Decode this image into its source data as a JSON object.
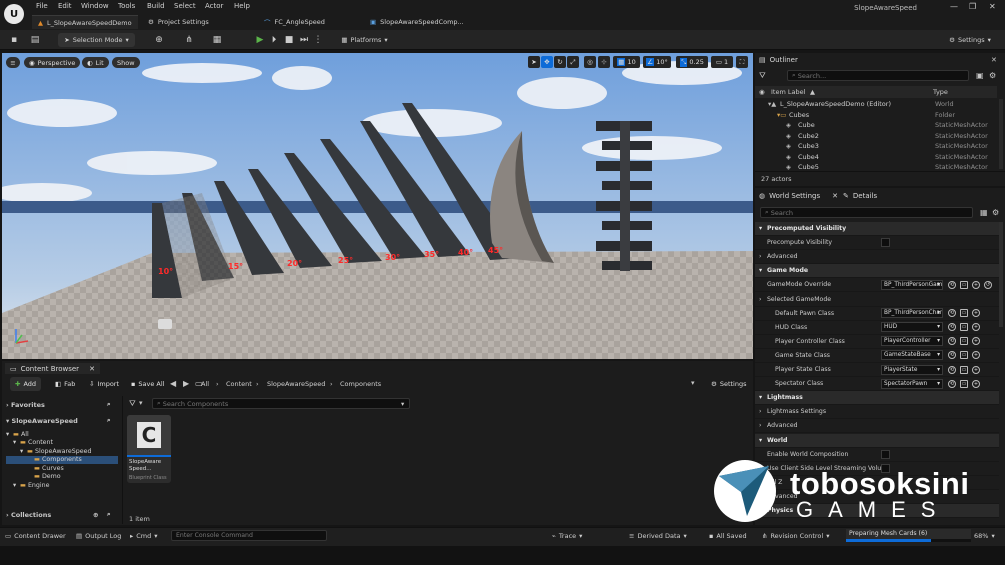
{
  "menu": [
    "File",
    "Edit",
    "Window",
    "Tools",
    "Build",
    "Select",
    "Actor",
    "Help"
  ],
  "window_title": "SlopeAwareSpeed",
  "doc_tabs": [
    "L_SlopeAwareSpeedDemo",
    "Project Settings",
    "FC_AngleSpeed",
    "SlopeAwareSpeedComp..."
  ],
  "toolbar": {
    "selection_mode": "Selection Mode",
    "platforms": "Platforms",
    "settings": "Settings"
  },
  "viewport": {
    "perspective": "Perspective",
    "lit": "Lit",
    "show": "Show",
    "grid_snap": "10",
    "rotation_snap": "10°",
    "scale_snap": "0.25",
    "camera_speed": "1",
    "angle_labels": [
      "10°",
      "15°",
      "20°",
      "25°",
      "30°",
      "35°",
      "40°",
      "45°"
    ]
  },
  "outliner": {
    "tab": "Outliner",
    "search_placeholder": "Search...",
    "col_label": "Item Label",
    "col_type": "Type",
    "rows": [
      {
        "label": "L_SlopeAwareSpeedDemo (Editor)",
        "type": "World",
        "indent": 1
      },
      {
        "label": "Cubes",
        "type": "Folder",
        "indent": 2
      },
      {
        "label": "Cube",
        "type": "StaticMeshActor",
        "indent": 3
      },
      {
        "label": "Cube2",
        "type": "StaticMeshActor",
        "indent": 3
      },
      {
        "label": "Cube3",
        "type": "StaticMeshActor",
        "indent": 3
      },
      {
        "label": "Cube4",
        "type": "StaticMeshActor",
        "indent": 3
      },
      {
        "label": "Cube5",
        "type": "StaticMeshActor",
        "indent": 3
      }
    ],
    "actor_count": "27 actors"
  },
  "world_settings": {
    "tab": "World Settings",
    "details_tab": "Details",
    "search_placeholder": "Search",
    "rows": [
      {
        "kind": "cat",
        "label": "Precomputed Visibility"
      },
      {
        "kind": "check",
        "label": "Precompute Visibility"
      },
      {
        "kind": "sub",
        "label": "Advanced"
      },
      {
        "kind": "cat",
        "label": "Game Mode"
      },
      {
        "kind": "drop",
        "label": "GameMode Override",
        "value": "BP_ThirdPersonGameMode"
      },
      {
        "kind": "sub",
        "label": "Selected GameMode"
      },
      {
        "kind": "drop",
        "label": "Default Pawn Class",
        "value": "BP_ThirdPersonCharacter"
      },
      {
        "kind": "drop",
        "label": "HUD Class",
        "value": "HUD"
      },
      {
        "kind": "drop",
        "label": "Player Controller Class",
        "value": "PlayerController"
      },
      {
        "kind": "drop",
        "label": "Game State Class",
        "value": "GameStateBase"
      },
      {
        "kind": "drop",
        "label": "Player State Class",
        "value": "PlayerState"
      },
      {
        "kind": "drop",
        "label": "Spectator Class",
        "value": "SpectatorPawn"
      },
      {
        "kind": "cat",
        "label": "Lightmass"
      },
      {
        "kind": "sub",
        "label": "Lightmass Settings"
      },
      {
        "kind": "sub",
        "label": "Advanced"
      },
      {
        "kind": "cat",
        "label": "World"
      },
      {
        "kind": "check",
        "label": "Enable World Composition"
      },
      {
        "kind": "check",
        "label": "Use Client Side Level Streaming Volu..."
      },
      {
        "kind": "plain",
        "label": "Kill Z"
      },
      {
        "kind": "sub",
        "label": "Advanced"
      },
      {
        "kind": "cat",
        "label": "Physics"
      }
    ]
  },
  "content_browser": {
    "tab": "Content Browser",
    "add": "Add",
    "fab": "Fab",
    "import": "Import",
    "save_all": "Save All",
    "breadcrumb": [
      "All",
      "Content",
      "SlopeAwareSpeed",
      "Components"
    ],
    "settings": "Settings",
    "search_placeholder": "Search Components",
    "favorites": "Favorites",
    "project": "SlopeAwareSpeed",
    "tree": [
      {
        "label": "All",
        "level": 0
      },
      {
        "label": "Content",
        "level": 1
      },
      {
        "label": "SlopeAwareSpeed",
        "level": 2
      },
      {
        "label": "Components",
        "level": 3,
        "selected": true
      },
      {
        "label": "Curves",
        "level": 3
      },
      {
        "label": "Demo",
        "level": 3
      },
      {
        "label": "Engine",
        "level": 1
      }
    ],
    "collections": "Collections",
    "asset_name": "SlopeAware Speed...",
    "asset_type": "Blueprint Class",
    "item_count": "1 item"
  },
  "statusbar": {
    "content_drawer": "Content Drawer",
    "output_log": "Output Log",
    "cmd": "Cmd",
    "console_placeholder": "Enter Console Command",
    "trace": "Trace",
    "derived_data": "Derived Data",
    "all_saved": "All Saved",
    "revision_control": "Revision Control",
    "progress_label": "Preparing Mesh Cards (6)",
    "progress_pct": "68%",
    "progress_value": 0.68
  },
  "watermark": {
    "line1": "tobosoksini",
    "line2": "GAMES"
  },
  "colors": {
    "accent": "#0d6bd8",
    "angle_text": "#ff2a2a",
    "play_green": "#5bb44a"
  }
}
